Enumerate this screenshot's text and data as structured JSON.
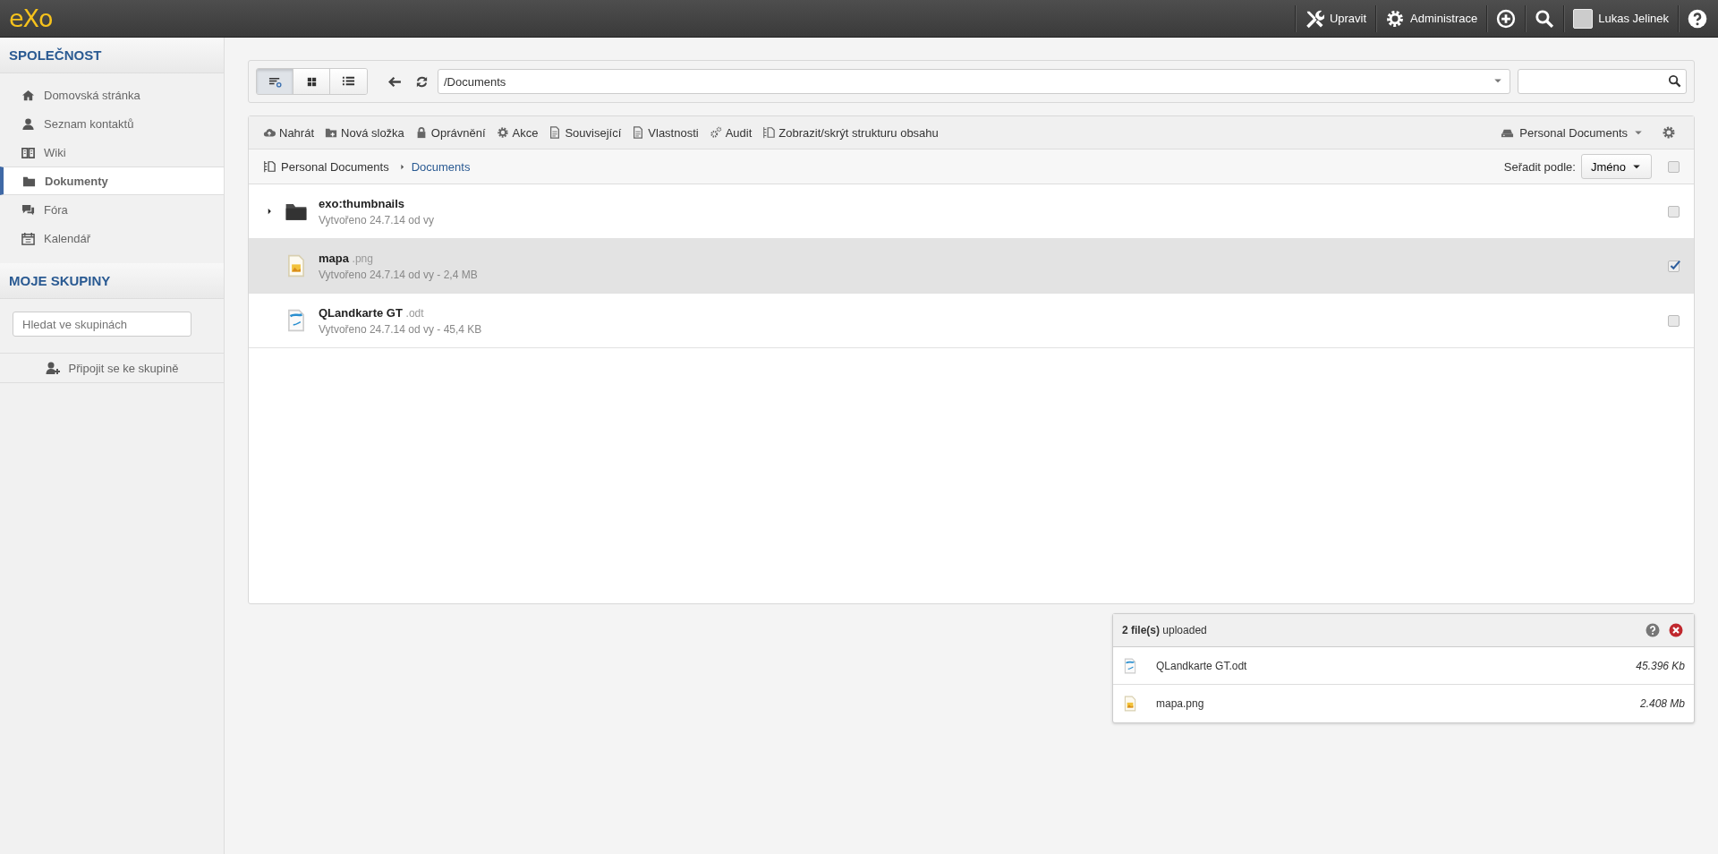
{
  "topbar": {
    "logo": "eXo",
    "actions": [
      {
        "label": "Upravit"
      },
      {
        "label": "Administrace"
      }
    ],
    "user": "Lukas Jelinek"
  },
  "sidebar": {
    "sections": [
      {
        "title": "SPOLEČNOST",
        "items": [
          {
            "label": "Domovská stránka",
            "selected": false
          },
          {
            "label": "Seznam kontaktů",
            "selected": false
          },
          {
            "label": "Wiki",
            "selected": false
          },
          {
            "label": "Dokumenty",
            "selected": true
          },
          {
            "label": "Fóra",
            "selected": false
          },
          {
            "label": "Kalendář",
            "selected": false
          }
        ]
      },
      {
        "title": "MOJE SKUPINY",
        "search": {
          "placeholder": "Hledat ve skupinách"
        },
        "join": "Připojit se ke skupině"
      }
    ]
  },
  "view_buttons": [
    {
      "selected": true
    },
    {
      "selected": false
    },
    {
      "selected": false
    }
  ],
  "address": {
    "value": "/Documents"
  },
  "actions": [
    "Nahrát",
    "Nová složka",
    "Oprávnění",
    "Akce",
    "Související",
    "Vlastnosti",
    "Audit",
    "Zobrazit/skrýt strukturu obsahu"
  ],
  "drive": "Personal Documents",
  "breadcrumb": [
    {
      "label": "Personal Documents",
      "current": false
    },
    {
      "label": "Documents",
      "current": true
    }
  ],
  "sort": {
    "label": "Seřadit podle:",
    "value": "Jméno"
  },
  "select_all": {
    "checked": false
  },
  "rows": [
    {
      "kind": "folder",
      "name": "exo:thumbnails",
      "ext": "",
      "meta": "Vytvořeno 24.7.14 od vy",
      "selected": false
    },
    {
      "kind": "image",
      "name": "mapa",
      "ext": ".png",
      "meta": "Vytvořeno 24.7.14 od vy - 2,4 MB",
      "selected": true
    },
    {
      "kind": "document",
      "name": "QLandkarte GT",
      "ext": ".odt",
      "meta": "Vytvořeno 24.7.14 od vy - 45,4 KB",
      "selected": false
    }
  ],
  "upload": {
    "title": "**2 file(s)** uploaded",
    "files": [
      {
        "kind": "document",
        "name": "QLandkarte GT.odt",
        "size": "45.396 Kb"
      },
      {
        "kind": "image",
        "name": "mapa.png",
        "size": "2.408 Mb"
      }
    ]
  }
}
